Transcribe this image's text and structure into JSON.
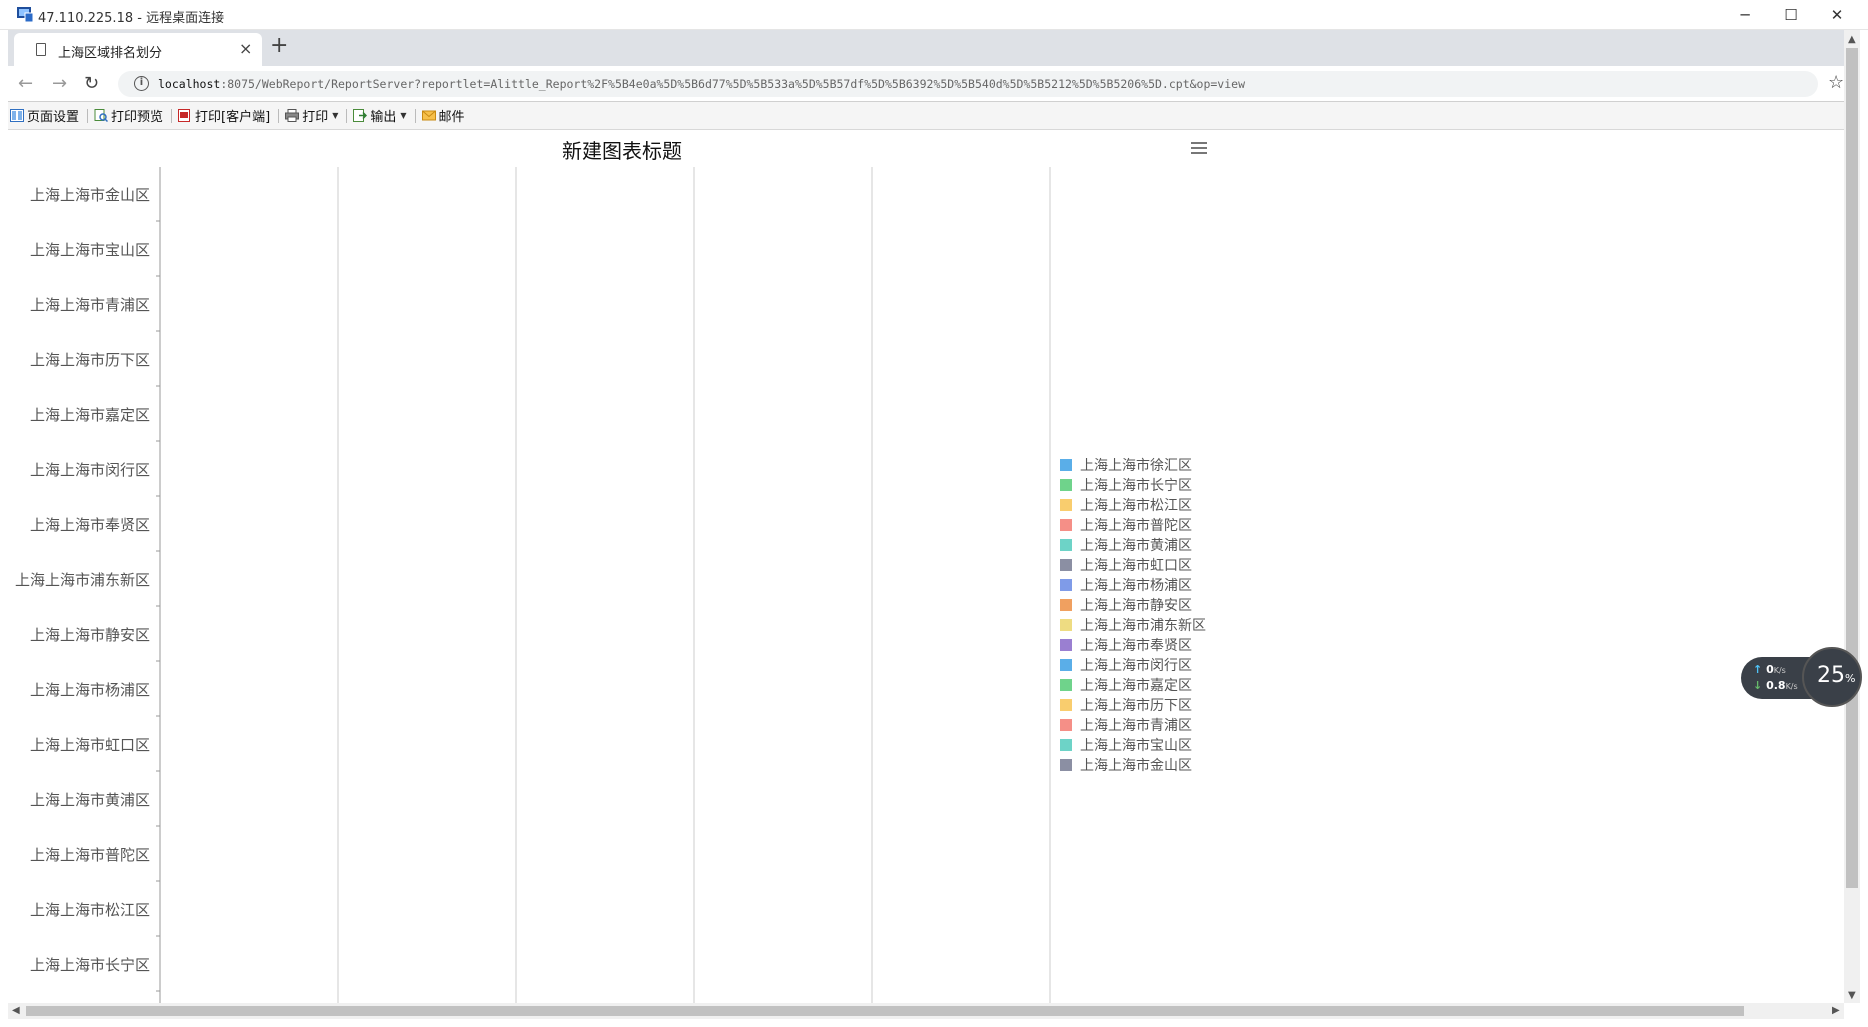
{
  "rdp": {
    "title": "47.110.225.18 - 远程桌面连接"
  },
  "browser": {
    "tab_title": "上海区域排名划分",
    "url_host": "localhost",
    "url_rest": ":8075/WebReport/ReportServer?reportlet=Alittle_Report%2F%5B4e0a%5D%5B6d77%5D%5B533a%5D%5B57df%5D%5B6392%5D%5B540d%5D%5B5212%5D%5B5206%5D.cpt&op=view"
  },
  "report_toolbar": {
    "items": [
      {
        "label": "页面设置",
        "icon": "page-setup-icon"
      },
      {
        "label": "打印预览",
        "icon": "print-preview-icon"
      },
      {
        "label": "打印[客户端]",
        "icon": "pdf-print-icon"
      },
      {
        "label": "打印",
        "icon": "printer-icon",
        "dropdown": true
      },
      {
        "label": "输出",
        "icon": "export-icon",
        "dropdown": true
      },
      {
        "label": "邮件",
        "icon": "mail-icon"
      }
    ]
  },
  "chart_data": {
    "type": "bar",
    "title": "新建图表标题",
    "categories": [
      "上海上海市金山区",
      "上海上海市宝山区",
      "上海上海市青浦区",
      "上海上海市历下区",
      "上海上海市嘉定区",
      "上海上海市闵行区",
      "上海上海市奉贤区",
      "上海上海市浦东新区",
      "上海上海市静安区",
      "上海上海市杨浦区",
      "上海上海市虹口区",
      "上海上海市黄浦区",
      "上海上海市普陀区",
      "上海上海市松江区",
      "上海上海市长宁区"
    ],
    "orientation": "horizontal",
    "grid": true,
    "vertical_gridlines": 5,
    "legend_position": "right",
    "legend": [
      {
        "name": "上海上海市徐汇区",
        "color": "#5aaee8"
      },
      {
        "name": "上海上海市长宁区",
        "color": "#6fd38b"
      },
      {
        "name": "上海上海市松江区",
        "color": "#f9cd6e"
      },
      {
        "name": "上海上海市普陀区",
        "color": "#f58f87"
      },
      {
        "name": "上海上海市黄浦区",
        "color": "#6dd3c7"
      },
      {
        "name": "上海上海市虹口区",
        "color": "#8b8fa3"
      },
      {
        "name": "上海上海市杨浦区",
        "color": "#7f9be8"
      },
      {
        "name": "上海上海市静安区",
        "color": "#f0a060"
      },
      {
        "name": "上海上海市浦东新区",
        "color": "#eedc82"
      },
      {
        "name": "上海上海市奉贤区",
        "color": "#9a7fd1"
      },
      {
        "name": "上海上海市闵行区",
        "color": "#5aaee8"
      },
      {
        "name": "上海上海市嘉定区",
        "color": "#6fd38b"
      },
      {
        "name": "上海上海市历下区",
        "color": "#f9cd6e"
      },
      {
        "name": "上海上海市青浦区",
        "color": "#f58f87"
      },
      {
        "name": "上海上海市宝山区",
        "color": "#6dd3c7"
      },
      {
        "name": "上海上海市金山区",
        "color": "#8b8fa3"
      }
    ]
  },
  "net_widget": {
    "up_value": "0",
    "up_unit": "K/s",
    "down_value": "0.8",
    "down_unit": "K/s",
    "cpu_value": "25",
    "cpu_unit": "%"
  }
}
